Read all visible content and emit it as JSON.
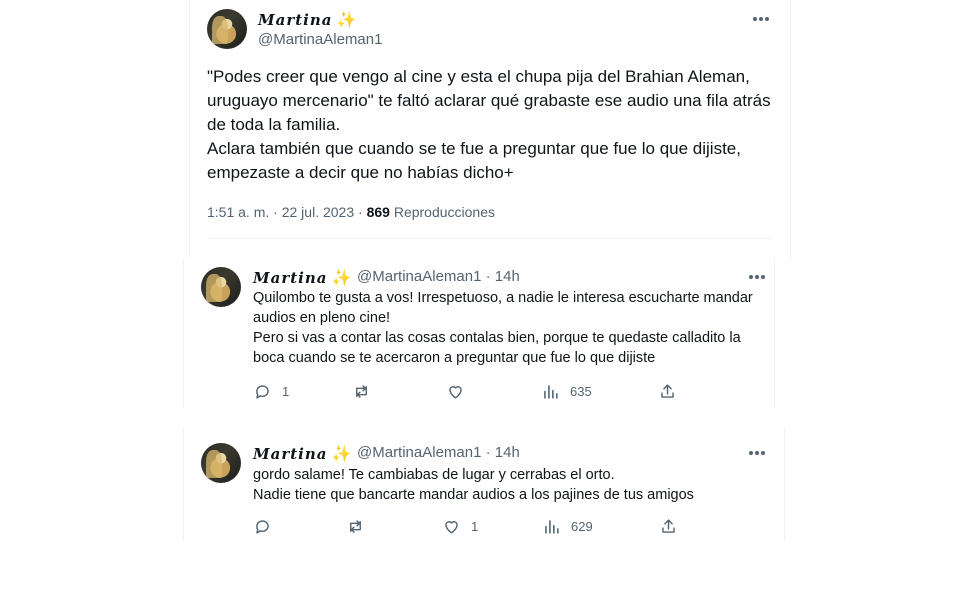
{
  "main_tweet": {
    "author": {
      "name": "Martina",
      "emoji": "✨",
      "handle": "@MartinaAleman1"
    },
    "text_lines": [
      "\"Podes creer que vengo al cine y esta el chupa pija del Brahian Aleman, uruguayo mercenario\" te faltó aclarar qué grabaste ese audio una fila atrás de toda la familia.",
      "Aclara también que cuando se te fue a preguntar que fue lo que dijiste, empezaste a decir que no habías dicho+"
    ],
    "time": "1:51 a. m.",
    "date": "22 jul. 2023",
    "separator": "·",
    "views_count": "869",
    "views_label": "Reproducciones"
  },
  "replies": [
    {
      "name": "Martina",
      "emoji": "✨",
      "handle": "@MartinaAleman1",
      "time_ago": "· 14h",
      "text_lines": [
        "Quilombo te gusta a vos! Irrespetuoso, a nadie le interesa escucharte mandar audios en pleno cine!",
        "Pero si vas a contar las cosas contalas bien, porque te quedaste calladito la boca cuando se te acercaron a preguntar que fue lo que dijiste"
      ],
      "actions": {
        "replies": "1",
        "retweets": "",
        "likes": "",
        "views": "635"
      }
    },
    {
      "name": "Martina",
      "emoji": "✨",
      "handle": "@MartinaAleman1",
      "time_ago": "· 14h",
      "text_lines": [
        "gordo salame! Te cambiabas de lugar y cerrabas el orto.",
        "Nadie tiene que bancarte mandar audios a los pajines de tus amigos"
      ],
      "actions": {
        "replies": "",
        "retweets": "",
        "likes": "1",
        "views": "629"
      }
    }
  ],
  "icons": [
    "more-icon",
    "reply-icon",
    "retweet-icon",
    "like-icon",
    "views-icon",
    "share-icon"
  ],
  "colors": {
    "text": "#0f1419",
    "secondary": "#536471",
    "sparkle": "#f5c23b",
    "divider": "#eff3f4"
  }
}
